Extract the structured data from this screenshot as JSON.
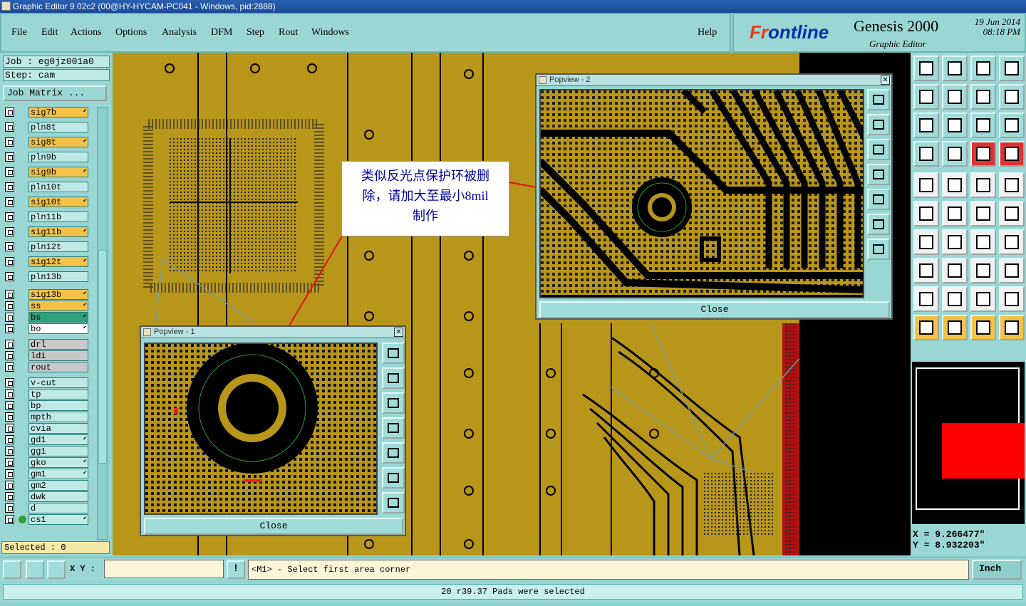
{
  "window": {
    "title": "Graphic Editor 9.02c2 (00@HY-HYCAM-PC041 - Windows, pid:2888)"
  },
  "menu": {
    "items": [
      "File",
      "Edit",
      "Actions",
      "Options",
      "Analysis",
      "DFM",
      "Step",
      "Rout",
      "Windows"
    ],
    "help": "Help"
  },
  "brand": {
    "logo_a": "Fr",
    "logo_b": "ontline",
    "product": "Genesis 2000",
    "subtitle": "Graphic Editor",
    "date": "19 Jun 2014",
    "time": "08:18 PM"
  },
  "job": {
    "job_label": "Job : eg0jz001a0",
    "step_label": "Step: cam",
    "matrix_button": "Job Matrix ..."
  },
  "layers": [
    {
      "name": "sig7b",
      "color": "#f3c246",
      "arrow": true
    },
    {
      "name": "pln8t",
      "color": "#bfe9e6",
      "arrow": false
    },
    {
      "name": "sig8t",
      "color": "#f3c246",
      "arrow": true
    },
    {
      "name": "pln9b",
      "color": "#bfe9e6",
      "arrow": false
    },
    {
      "name": "sig9b",
      "color": "#f3c246",
      "arrow": true
    },
    {
      "name": "pln10t",
      "color": "#bfe9e6",
      "arrow": false
    },
    {
      "name": "sig10t",
      "color": "#f3c246",
      "arrow": true
    },
    {
      "name": "pln11b",
      "color": "#bfe9e6",
      "arrow": false
    },
    {
      "name": "sig11b",
      "color": "#f3c246",
      "arrow": true
    },
    {
      "name": "pln12t",
      "color": "#bfe9e6",
      "arrow": false
    },
    {
      "name": "sig12t",
      "color": "#f3c246",
      "arrow": true
    },
    {
      "name": "pln13b",
      "color": "#bfe9e6",
      "arrow": false
    },
    {
      "name": "sig13b",
      "color": "#f3c246",
      "arrow": true
    },
    {
      "name": "ss",
      "color": "#f3c246",
      "arrow": true
    },
    {
      "name": "bs",
      "color": "#2ea07a",
      "arrow": true
    },
    {
      "name": "bo",
      "color": "#ffffff",
      "arrow": true
    },
    {
      "name": "drl",
      "color": "#c8c8c8",
      "arrow": false
    },
    {
      "name": "ldi",
      "color": "#c8c8c8",
      "arrow": false
    },
    {
      "name": "rout",
      "color": "#c8c8c8",
      "arrow": false
    },
    {
      "name": "v-cut",
      "color": "#bfe9e6",
      "arrow": false
    },
    {
      "name": "tp",
      "color": "#bfe9e6",
      "arrow": false
    },
    {
      "name": "bp",
      "color": "#bfe9e6",
      "arrow": false
    },
    {
      "name": "mpth",
      "color": "#bfe9e6",
      "arrow": false
    },
    {
      "name": "cvia",
      "color": "#bfe9e6",
      "arrow": false
    },
    {
      "name": "gd1",
      "color": "#bfe9e6",
      "arrow": true
    },
    {
      "name": "gg1",
      "color": "#bfe9e6",
      "arrow": false
    },
    {
      "name": "gko",
      "color": "#bfe9e6",
      "arrow": true
    },
    {
      "name": "gm1",
      "color": "#bfe9e6",
      "arrow": true
    },
    {
      "name": "gm2",
      "color": "#bfe9e6",
      "arrow": false
    },
    {
      "name": "dwk",
      "color": "#bfe9e6",
      "arrow": false
    },
    {
      "name": "d",
      "color": "#bfe9e6",
      "arrow": false
    },
    {
      "name": "cs1",
      "color": "#bfe9e6",
      "arrow": true,
      "active": true
    }
  ],
  "selected": "Selected : 0",
  "callout": {
    "line1": "类似反光点保护环被删",
    "line2": "除，请加大至最小8mil",
    "line3": "制作"
  },
  "popview1": {
    "title": "Popview - 1",
    "close": "Close"
  },
  "popview2": {
    "title": "Popview - 2",
    "close": "Close"
  },
  "coords": {
    "x": "X = 9.266477\"",
    "y": "Y = 8.932203\""
  },
  "bottom": {
    "xy_label": "X Y :",
    "xy_value": "",
    "message": "<M1> - Select first area corner",
    "units": "Inch"
  },
  "status": "20 r39.37 Pads were selected"
}
